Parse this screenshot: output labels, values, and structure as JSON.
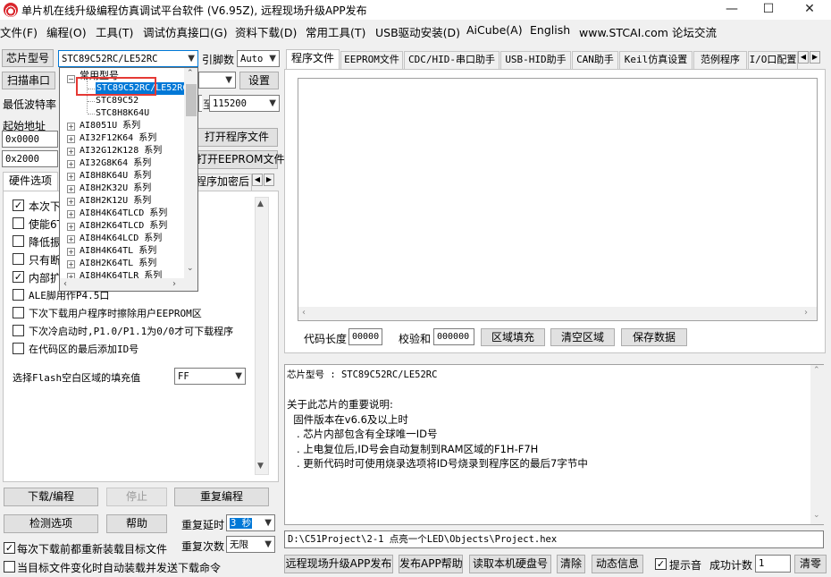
{
  "window": {
    "title": "单片机在线升级编程仿真调试平台软件 (V6.95Z), 远程现场升级APP发布",
    "minimize": "—",
    "maximize": "☐",
    "close": "✕"
  },
  "menu": [
    "文件(F)",
    "编程(O)",
    "工具(T)",
    "调试仿真接口(G)",
    "资料下载(D)",
    "常用工具(T)",
    "USB驱动安装(D)",
    "AiCube(A)",
    "English",
    "www.STCAI.com 论坛交流"
  ],
  "left": {
    "chip_label": "芯片型号",
    "chip_value": "STC89C52RC/LE52RC",
    "pin_label": "引脚数",
    "pin_value": "Auto",
    "scan_button": "扫描串口",
    "settings_button": "设置",
    "min_baud_label": "最低波特率",
    "max_baud_value": "115200",
    "start_addr_label": "起始地址",
    "addr1": "0x0000",
    "addr2": "0x2000",
    "open_program_button": "打开程序文件",
    "open_eeprom_button": "打开EEPROM文件",
    "tab_hw": "硬件选项",
    "tab_encrypt": "程序加密后",
    "options": [
      {
        "label": "本次下",
        "checked": true
      },
      {
        "label": "使能6T",
        "checked": false
      },
      {
        "label": "降低振",
        "checked": false
      },
      {
        "label": "只有断",
        "checked": false
      },
      {
        "label": "内部扩",
        "checked": true
      },
      {
        "label": "ALE脚用作P4.5口",
        "checked": false
      },
      {
        "label": "下次下载用户程序时擦除用户EEPROM区",
        "checked": false
      },
      {
        "label": "下次冷启动时,P1.0/P1.1为0/0才可下载程序",
        "checked": false
      },
      {
        "label": "在代码区的最后添加ID号",
        "checked": false
      }
    ],
    "fill_label": "选择Flash空白区域的填充值",
    "fill_value": "FF",
    "download_button": "下载/编程",
    "stop_button": "停止",
    "reprogram_button": "重复编程",
    "check_button": "检测选项",
    "help_button": "帮助",
    "delay_label": "重复延时",
    "delay_value": "3 秒",
    "count_label": "重复次数",
    "count_value": "无限",
    "reload_label": "每次下载前都重新装载目标文件",
    "reload_checked": true,
    "auto_label": "当目标文件变化时自动装载并发送下载命令",
    "auto_checked": false
  },
  "dropdown": {
    "group": "常用型号",
    "items": [
      "STC89C52RC/LE52RC",
      "STC89C52",
      "STC8H8K64U"
    ],
    "series": [
      "AI8051U 系列",
      "AI32F12K64 系列",
      "AI32G12K128 系列",
      "AI32G8K64 系列",
      "AI8H8K64U 系列",
      "AI8H2K32U 系列",
      "AI8H2K12U 系列",
      "AI8H4K64TLCD 系列",
      "AI8H2K64TLCD 系列",
      "AI8H4K64LCD 系列",
      "AI8H4K64TL 系列",
      "AI8H2K64TL 系列",
      "AI8H4K64TLR 系列"
    ]
  },
  "tabs": [
    "程序文件",
    "EEPROM文件",
    "CDC/HID-串口助手",
    "USB-HID助手",
    "CAN助手",
    "Keil仿真设置",
    "范例程序",
    "I/O口配置"
  ],
  "code": {
    "len_label": "代码长度",
    "len_value": "00000",
    "checksum_label": "校验和",
    "checksum_value": "000000",
    "fill_button": "区域填充",
    "clear_button": "清空区域",
    "save_button": "保存数据"
  },
  "info": {
    "lines": [
      "芯片型号 : STC89C52RC/LE52RC",
      "",
      "关于此芯片的重要说明:",
      "  固件版本在v6.6及以上时",
      "   . 芯片内部包含有全球唯一ID号",
      "   . 上电复位后,ID号会自动复制到RAM区域的F1H-F7H",
      "   . 更新代码时可使用烧录选项将ID号烧录到程序区的最后7字节中"
    ]
  },
  "path": "D:\\C51Project\\2-1 点亮一个LED\\Objects\\Project.hex",
  "bottom": {
    "remote_button": "远程现场升级APP发布",
    "publish_help_button": "发布APP帮助",
    "read_disk_button": "读取本机硬盘号",
    "clear_button": "清除",
    "dynamic_button": "动态信息",
    "beep_label": "提示音",
    "beep_checked": true,
    "success_label": "成功计数",
    "success_value": "1",
    "clear2_button": "清零"
  }
}
